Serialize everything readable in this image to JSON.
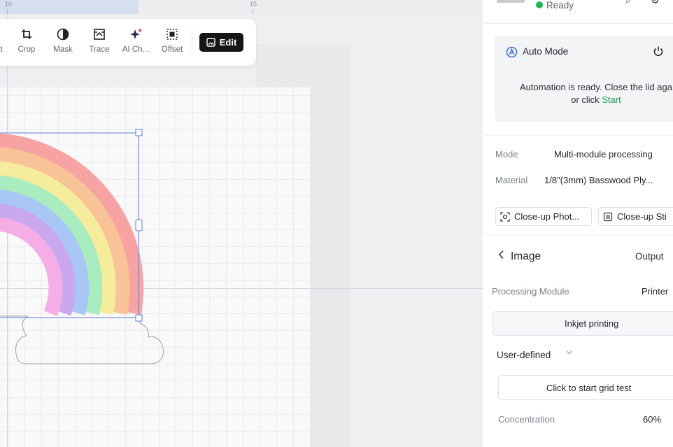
{
  "ruler": {
    "marks": [
      "10",
      "15"
    ]
  },
  "toolbar": {
    "tools": [
      {
        "label": "t",
        "icon": "partial-tool-icon"
      },
      {
        "label": "Crop",
        "icon": "crop-icon"
      },
      {
        "label": "Mask",
        "icon": "mask-icon"
      },
      {
        "label": "Trace",
        "icon": "trace-icon"
      },
      {
        "label": "AI Ch...",
        "icon": "ai-sparkle-icon"
      },
      {
        "label": "Offset",
        "icon": "offset-icon"
      }
    ],
    "edit_label": "Edit"
  },
  "device": {
    "status": "Ready",
    "status_color": "#21b356"
  },
  "auto_mode": {
    "title": "Auto Mode",
    "message_line1": "Automation is ready. Close the lid aga",
    "message_prefix": "or click ",
    "start_link": "Start"
  },
  "settings": {
    "mode_label": "Mode",
    "mode_value": "Multi-module processing",
    "material_label": "Material",
    "material_value": "1/8\"(3mm) Basswood Ply..."
  },
  "buttons": {
    "closeup_photo": "Close-up Phot...",
    "closeup_stitch": "Close-up Sti"
  },
  "image_section": {
    "title": "Image",
    "output_label": "Output",
    "module_label": "Processing Module",
    "module_value": "Printer",
    "printing_type": "Inkjet printing",
    "preset": "User-defined",
    "grid_test_label": "Click to start grid test",
    "concentration_label": "Concentration",
    "concentration_value": "60%"
  },
  "colors": {
    "accent_green": "#21b356",
    "selection_blue": "#5b7fd1",
    "edit_button": "#151515"
  }
}
